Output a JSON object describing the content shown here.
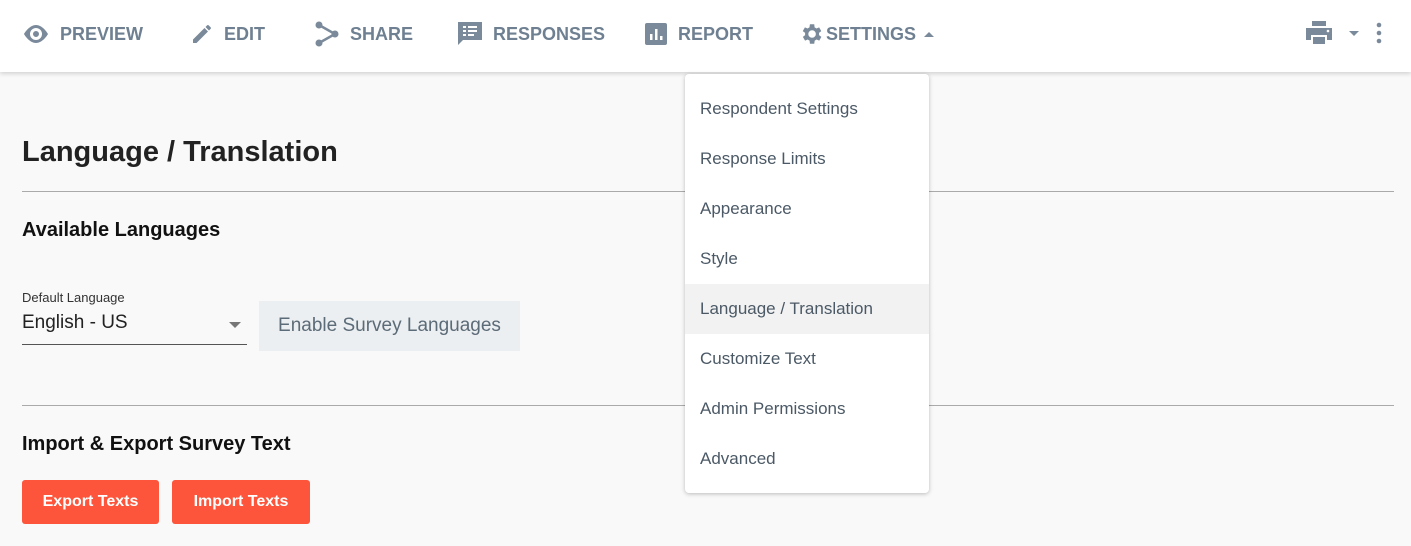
{
  "nav": {
    "preview": "PREVIEW",
    "edit": "EDIT",
    "share": "SHARE",
    "responses": "RESPONSES",
    "report": "REPORT",
    "settings": "SETTINGS"
  },
  "page": {
    "title": "Language / Translation",
    "available_heading": "Available Languages",
    "default_language_label": "Default Language",
    "default_language_value": "English - US",
    "enable_button": "Enable Survey Languages",
    "import_export_heading": "Import & Export Survey Text",
    "export_button": "Export Texts",
    "import_button": "Import Texts"
  },
  "settings_menu": {
    "items": [
      {
        "label": "Respondent Settings"
      },
      {
        "label": "Response Limits"
      },
      {
        "label": "Appearance"
      },
      {
        "label": "Style"
      },
      {
        "label": "Language / Translation"
      },
      {
        "label": "Customize Text"
      },
      {
        "label": "Admin Permissions"
      },
      {
        "label": "Advanced"
      }
    ],
    "active": "Language / Translation"
  },
  "colors": {
    "accent": "#fc553b",
    "nav": "#6e8091"
  }
}
